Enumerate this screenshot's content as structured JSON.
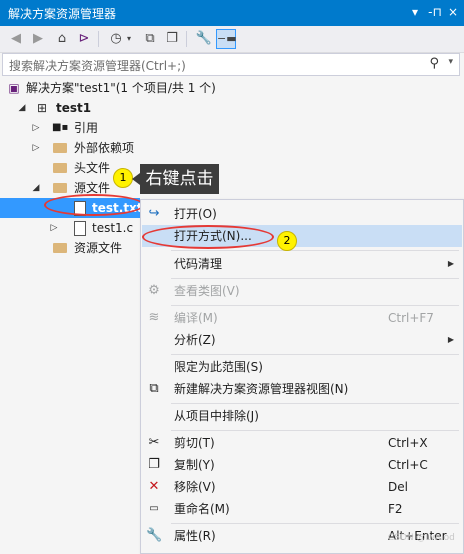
{
  "titlebar": {
    "title": "解决方案资源管理器",
    "pin_glyph": "▾",
    "autohide_glyph": "-⊓",
    "close_glyph": "×"
  },
  "toolbar": {
    "tools": [
      "back-icon",
      "forward-icon",
      "home-icon",
      "vs-icon",
      "history-icon",
      "dropdown",
      "collapse-icon",
      "copy-icon",
      "properties-icon",
      "preview-icon"
    ]
  },
  "search": {
    "placeholder": "搜索解决方案资源管理器(Ctrl+;)"
  },
  "tree": {
    "solution": "解决方案\"test1\"(1 个项目/共 1 个)",
    "project": "test1",
    "items": [
      {
        "label": "引用"
      },
      {
        "label": "外部依赖项"
      },
      {
        "label": "头文件"
      },
      {
        "label": "源文件"
      },
      {
        "label": "test.txt"
      },
      {
        "label": "test1.c"
      },
      {
        "label": "资源文件"
      }
    ]
  },
  "annotations": {
    "badge1": "1",
    "badge2": "2",
    "tooltip": "右键点击"
  },
  "menu": {
    "items": [
      {
        "label": "打开(O)",
        "shortcut": ""
      },
      {
        "label": "打开方式(N)...",
        "shortcut": ""
      },
      {
        "label": "代码清理",
        "shortcut": ""
      },
      {
        "label": "查看类图(V)",
        "shortcut": ""
      },
      {
        "label": "编译(M)",
        "shortcut": "Ctrl+F7"
      },
      {
        "label": "分析(Z)",
        "shortcut": ""
      },
      {
        "label": "限定为此范围(S)",
        "shortcut": ""
      },
      {
        "label": "新建解决方案资源管理器视图(N)",
        "shortcut": ""
      },
      {
        "label": "从项目中排除(J)",
        "shortcut": ""
      },
      {
        "label": "剪切(T)",
        "shortcut": "Ctrl+X"
      },
      {
        "label": "复制(Y)",
        "shortcut": "Ctrl+C"
      },
      {
        "label": "移除(V)",
        "shortcut": "Del"
      },
      {
        "label": "重命名(M)",
        "shortcut": "F2"
      },
      {
        "label": "属性(R)",
        "shortcut": "Alt+Enter"
      }
    ]
  },
  "watermark": "CSDN @Lwuod",
  "colors": {
    "accent": "#007acc",
    "selection": "#3399ff",
    "highlight": "#c9def5",
    "badge": "#fff200",
    "ellipse": "#e53935"
  }
}
